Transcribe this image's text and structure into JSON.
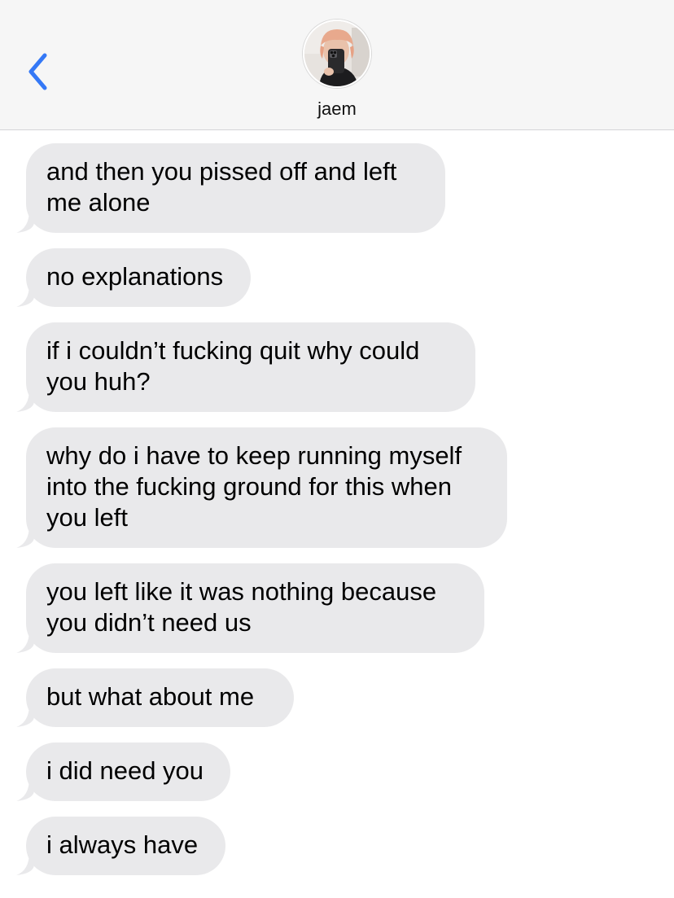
{
  "header": {
    "contact_name": "jaem",
    "back_icon": "chevron-left-icon",
    "accent_color": "#3478f6"
  },
  "messages": [
    {
      "lines": [
        "and then you pissed off and left",
        "me alone"
      ]
    },
    {
      "lines": [
        "no explanations"
      ]
    },
    {
      "lines": [
        "if i couldn’t fucking quit why could",
        "you huh?"
      ]
    },
    {
      "lines": [
        "why do i have to keep running myself",
        "into the fucking ground for this when",
        "you left"
      ]
    },
    {
      "lines": [
        "you left like it was nothing because",
        "you didn’t need us"
      ]
    },
    {
      "lines": [
        "but what about me"
      ]
    },
    {
      "lines": [
        "i did need you"
      ]
    },
    {
      "lines": [
        "i always have"
      ]
    }
  ],
  "colors": {
    "received_bubble": "#e9e9eb",
    "header_bg": "#f6f6f6"
  }
}
